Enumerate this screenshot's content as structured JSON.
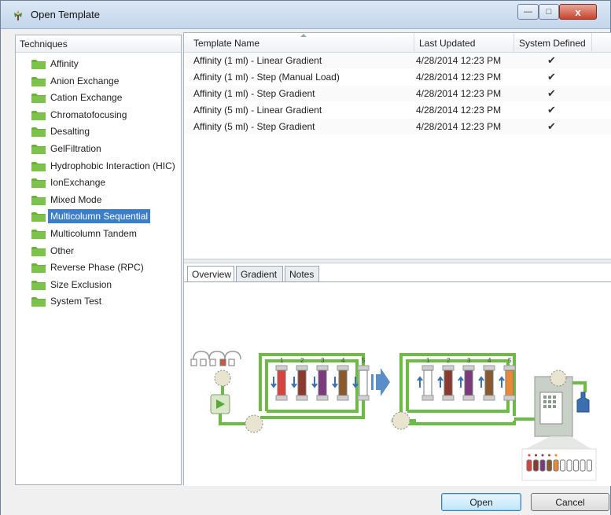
{
  "window": {
    "title": "Open Template",
    "min_glyph": "—",
    "max_glyph": "□",
    "close_glyph": "x"
  },
  "techniques": {
    "header": "Techniques",
    "items": [
      {
        "label": "Affinity",
        "selected": false
      },
      {
        "label": "Anion Exchange",
        "selected": false
      },
      {
        "label": "Cation Exchange",
        "selected": false
      },
      {
        "label": "Chromatofocusing",
        "selected": false
      },
      {
        "label": "Desalting",
        "selected": false
      },
      {
        "label": "GelFiltration",
        "selected": false
      },
      {
        "label": "Hydrophobic Interaction (HIC)",
        "selected": false
      },
      {
        "label": "IonExchange",
        "selected": false
      },
      {
        "label": "Mixed Mode",
        "selected": false
      },
      {
        "label": "Multicolumn Sequential",
        "selected": true
      },
      {
        "label": "Multicolumn Tandem",
        "selected": false
      },
      {
        "label": "Other",
        "selected": false
      },
      {
        "label": "Reverse Phase (RPC)",
        "selected": false
      },
      {
        "label": "Size Exclusion",
        "selected": false
      },
      {
        "label": "System Test",
        "selected": false
      }
    ]
  },
  "templates": {
    "columns": [
      "Template Name",
      "Last Updated",
      "System Defined"
    ],
    "rows": [
      {
        "name": "Affinity (1 ml) - Linear Gradient",
        "updated": "4/28/2014 12:23 PM",
        "system": "✔"
      },
      {
        "name": "Affinity (1 ml) - Step (Manual Load)",
        "updated": "4/28/2014 12:23 PM",
        "system": "✔"
      },
      {
        "name": "Affinity (1 ml) - Step Gradient",
        "updated": "4/28/2014 12:23 PM",
        "system": "✔"
      },
      {
        "name": "Affinity (5 ml) - Linear Gradient",
        "updated": "4/28/2014 12:23 PM",
        "system": "✔"
      },
      {
        "name": "Affinity (5 ml) - Step Gradient",
        "updated": "4/28/2014 12:23 PM",
        "system": "✔"
      }
    ]
  },
  "detail_tabs": [
    {
      "label": "Overview",
      "active": true
    },
    {
      "label": "Gradient",
      "active": false
    },
    {
      "label": "Notes",
      "active": false
    }
  ],
  "diagram": {
    "column_numbers": [
      "1",
      "2",
      "3",
      "4",
      "5"
    ],
    "colors": {
      "tube": "#6dbb45",
      "valve": "#e9e4cf",
      "col1": "#d9433e",
      "col2": "#8a3a2e",
      "col3": "#7a3a7c",
      "col4": "#8a5a2e",
      "col5": "#e8893a"
    }
  },
  "buttons": {
    "open": "Open",
    "cancel": "Cancel"
  }
}
